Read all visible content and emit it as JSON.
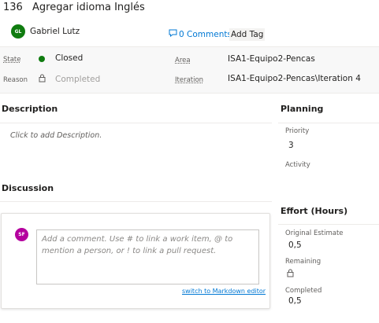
{
  "work_item": {
    "id": "136",
    "title": "Agregar idioma Inglés",
    "author_initials": "GL",
    "author_name": "Gabriel Lutz",
    "comments_link": "0 Comments",
    "add_tag_label": "Add Tag"
  },
  "fields": {
    "state_label": "State",
    "state_value": "Closed",
    "state_color": "#107c10",
    "reason_label": "Reason",
    "reason_value": "Completed",
    "area_label": "Area",
    "area_value": "ISA1-Equipo2-Pencas",
    "iteration_label": "Iteration",
    "iteration_value": "ISA1-Equipo2-Pencas\\Iteration 4"
  },
  "description": {
    "heading": "Description",
    "placeholder": "Click to add Description."
  },
  "discussion": {
    "heading": "Discussion",
    "user_initials": "SF",
    "comment_placeholder": "Add a comment. Use # to link a work item, @ to mention a person, or ! to link a pull request.",
    "markdown_link": "switch to Markdown editor"
  },
  "planning": {
    "heading": "Planning",
    "priority_label": "Priority",
    "priority_value": "3",
    "activity_label": "Activity"
  },
  "effort": {
    "heading": "Effort (Hours)",
    "original_label": "Original Estimate",
    "original_value": "0,5",
    "remaining_label": "Remaining",
    "completed_label": "Completed",
    "completed_value": "0,5"
  }
}
